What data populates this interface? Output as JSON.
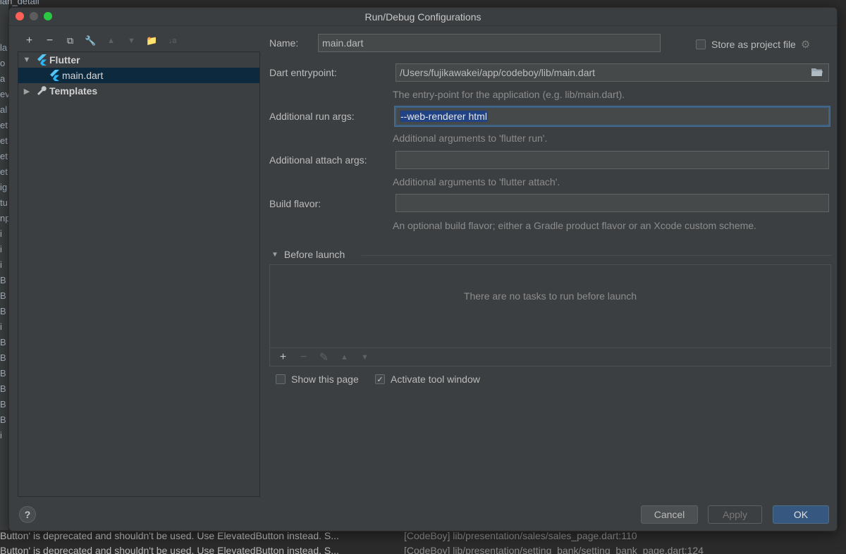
{
  "background": {
    "top_fragment": "lan_detail",
    "left_fragments": [
      "la",
      "o",
      "a",
      "ev",
      "al",
      "et",
      "et",
      "et",
      "et",
      "ig",
      "tu",
      "np",
      "i",
      "i",
      "i",
      "B",
      "B",
      "B",
      "i",
      "B",
      "B",
      "B",
      "B",
      "B",
      "B",
      "i"
    ],
    "bottom_lines": [
      {
        "text": "Button' is deprecated and shouldn't be used. Use ElevatedButton instead. S...",
        "location": "[CodeBoy] lib/presentation/sales/sales_page.dart:110"
      },
      {
        "text": "Button' is deprecated and shouldn't be used. Use ElevatedButton instead. S...",
        "location": "[CodeBoy] lib/presentation/setting_bank/setting_bank_page.dart:124"
      }
    ]
  },
  "dialog": {
    "title": "Run/Debug Configurations",
    "toolbar": [
      {
        "icon": "plus-icon",
        "glyph": "+",
        "disabled": false
      },
      {
        "icon": "minus-icon",
        "glyph": "−",
        "disabled": false
      },
      {
        "icon": "copy-icon",
        "glyph": "⧉",
        "disabled": false
      },
      {
        "icon": "wrench-icon",
        "glyph": "🔧",
        "disabled": false
      },
      {
        "icon": "move-up-icon",
        "glyph": "▲",
        "disabled": true
      },
      {
        "icon": "move-down-icon",
        "glyph": "▼",
        "disabled": true
      },
      {
        "icon": "new-folder-icon",
        "glyph": "📁",
        "disabled": false
      },
      {
        "icon": "sort-icon",
        "glyph": "↓a",
        "disabled": true
      }
    ],
    "tree": {
      "flutter_group": "Flutter",
      "selected_config": "main.dart",
      "templates": "Templates"
    },
    "form": {
      "name_label": "Name:",
      "name_value": "main.dart",
      "store_label": "Store as project file",
      "store_checked": false,
      "entrypoint_label": "Dart entrypoint:",
      "entrypoint_value": "/Users/fujikawakei/app/codeboy/lib/main.dart",
      "entrypoint_hint": "The entry-point for the application (e.g. lib/main.dart).",
      "run_args_label": "Additional run args:",
      "run_args_value": "--web-renderer html",
      "run_args_hint": "Additional arguments to 'flutter run'.",
      "attach_args_label": "Additional attach args:",
      "attach_args_value": "",
      "attach_args_hint": "Additional arguments to 'flutter attach'.",
      "flavor_label": "Build flavor:",
      "flavor_value": "",
      "flavor_hint": "An optional build flavor; either a Gradle product flavor or an Xcode custom scheme."
    },
    "before_launch": {
      "title": "Before launch",
      "empty_text": "There are no tasks to run before launch"
    },
    "options": {
      "show_page_label": "Show this page",
      "show_page_checked": false,
      "activate_tool_label": "Activate tool window",
      "activate_tool_checked": true
    },
    "buttons": {
      "help": "?",
      "cancel": "Cancel",
      "apply": "Apply",
      "ok": "OK"
    }
  }
}
